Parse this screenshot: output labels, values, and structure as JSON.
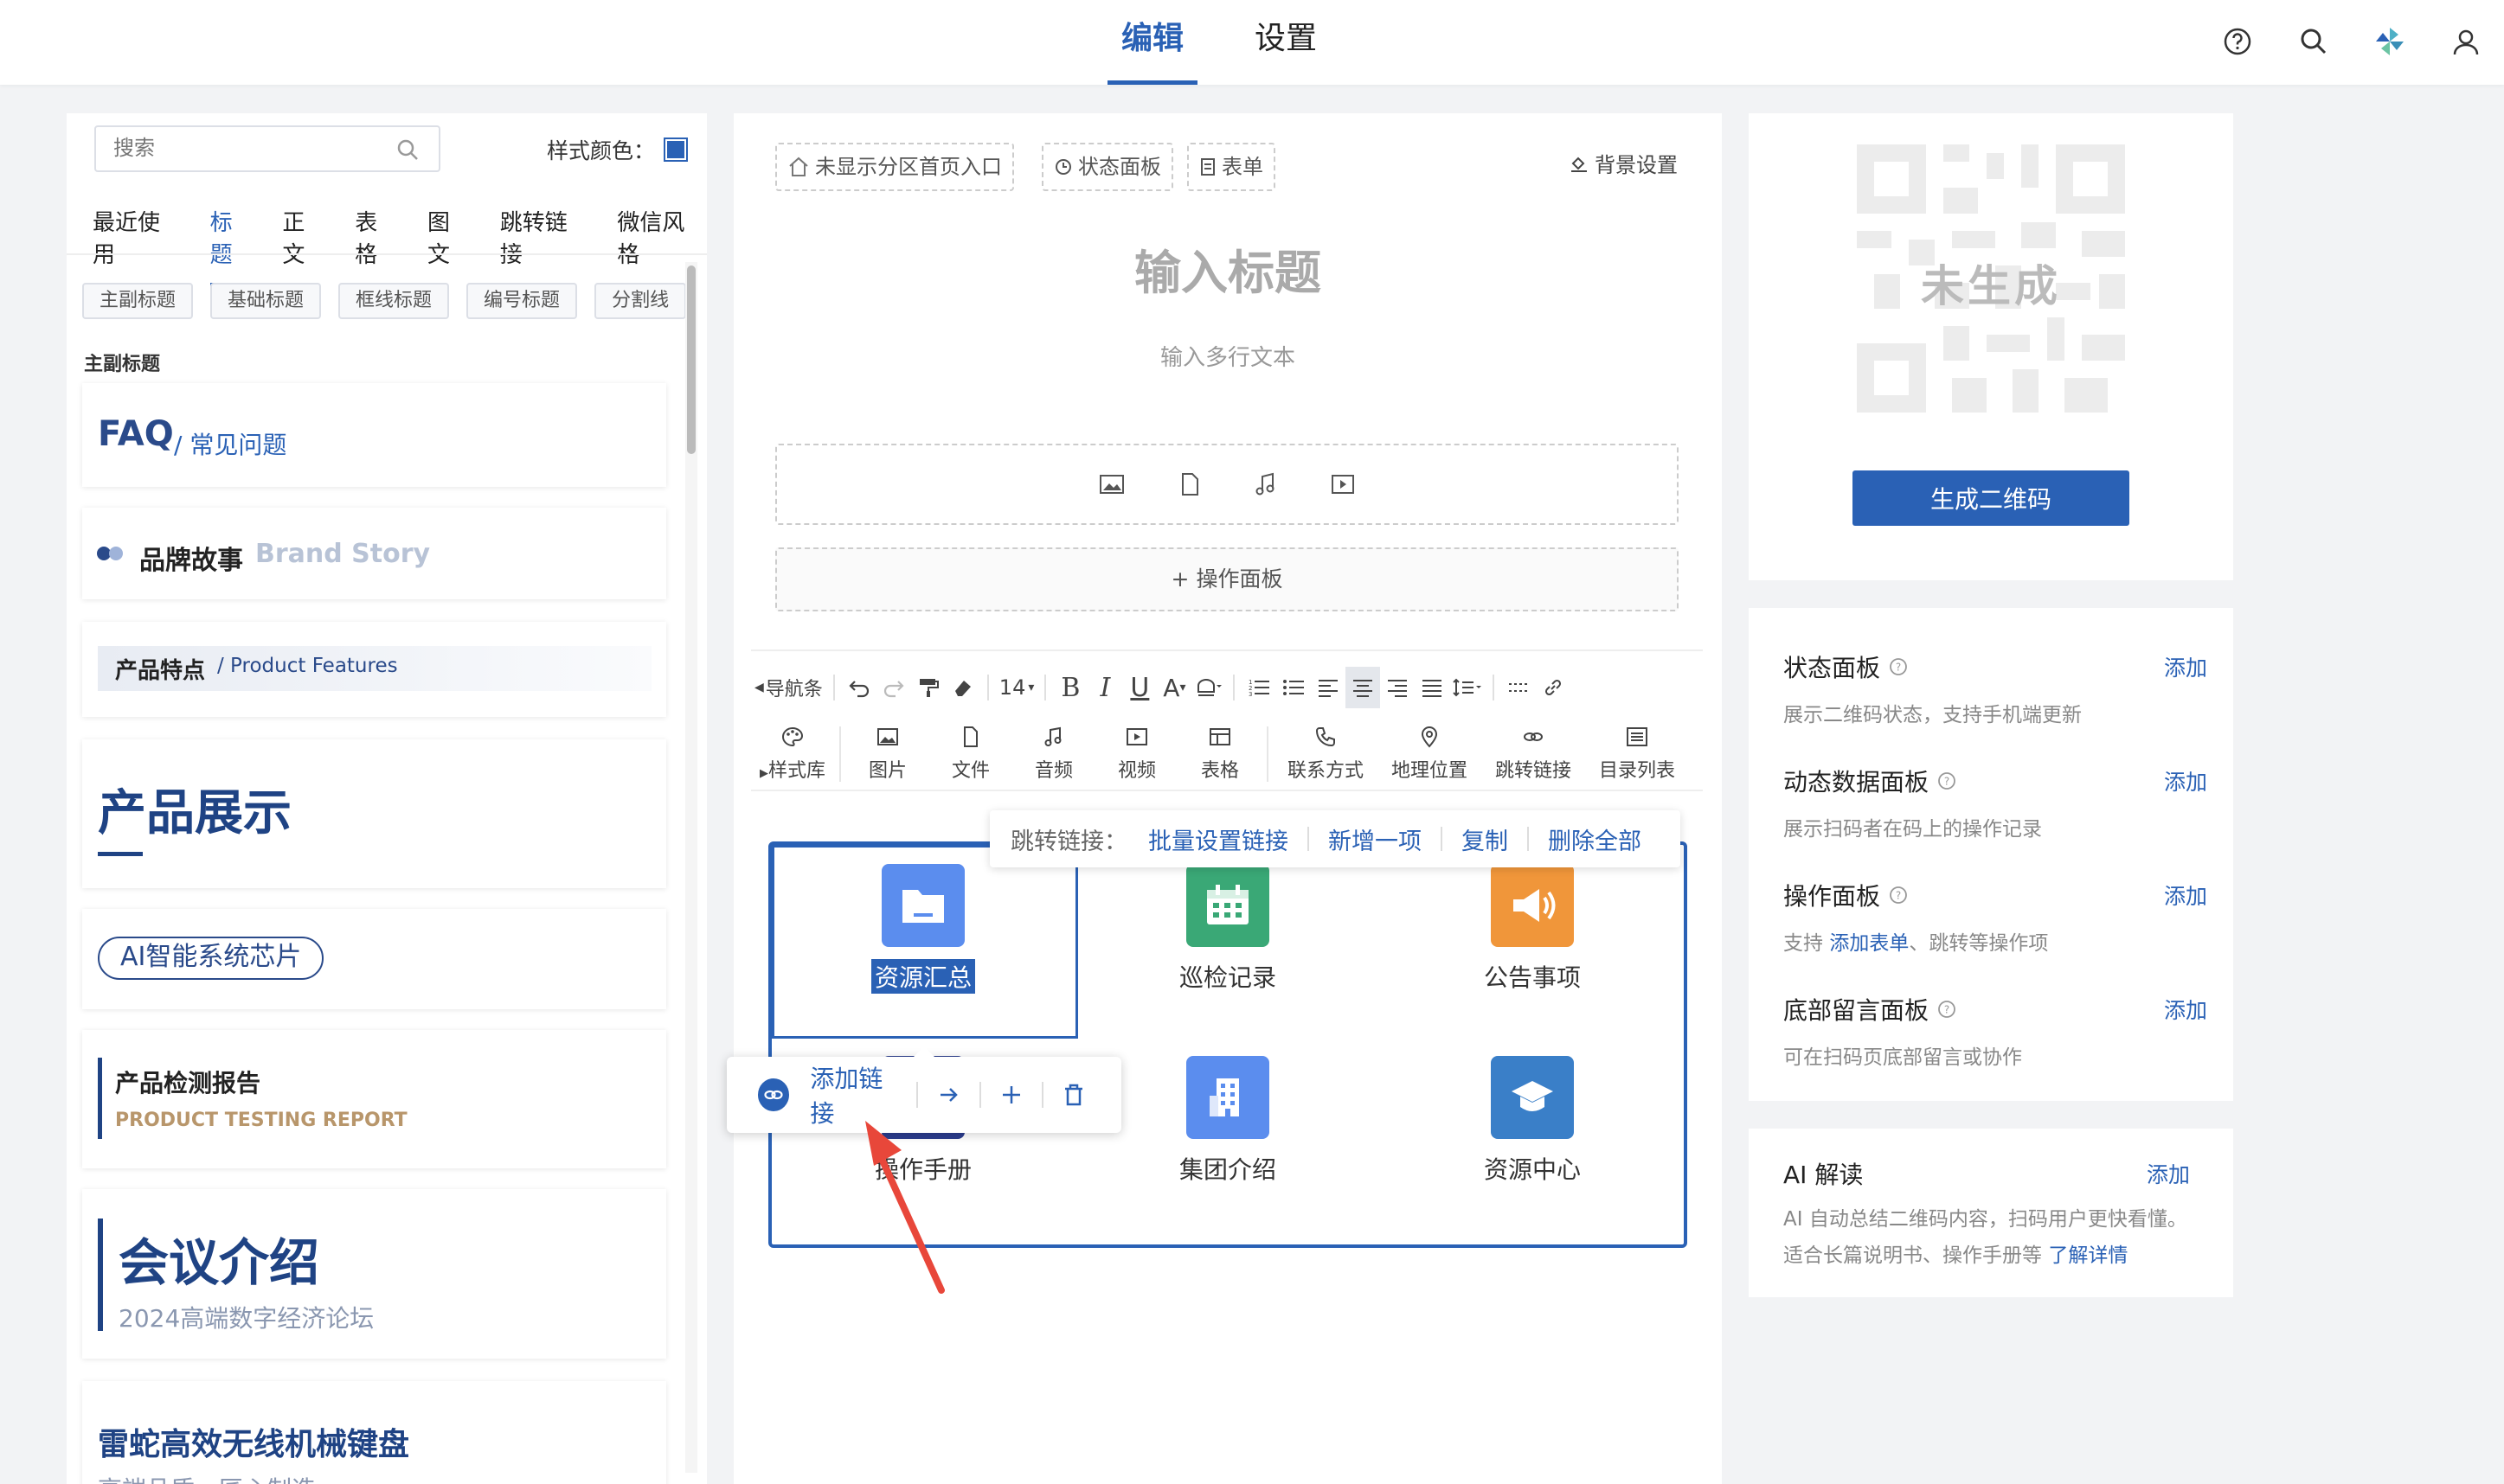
{
  "topnav": {
    "tabs": [
      "编辑",
      "设置"
    ]
  },
  "left": {
    "search_placeholder": "搜索",
    "style_color_label": "样式颜色：",
    "tabs": [
      "最近使用",
      "标题",
      "正文",
      "表格",
      "图文",
      "跳转链接",
      "微信风格"
    ],
    "chips": [
      "主副标题",
      "基础标题",
      "框线标题",
      "编号标题",
      "分割线"
    ],
    "section_title": "主副标题",
    "cards": {
      "faq_main": "FAQ",
      "faq_sub": "/ 常见问题",
      "brand_cn": "品牌故事",
      "brand_en": "Brand Story",
      "features_cn": "产品特点",
      "features_en": "/ Product Features",
      "showcase": "产品展示",
      "chip": "AI智能系统芯片",
      "report_cn": "产品检测报告",
      "report_en": "PRODUCT TESTING REPORT",
      "meeting_title": "会议介绍",
      "meeting_sub": "2024高端数字经济论坛",
      "keyboard_title": "雷蛇高效无线机械键盘",
      "keyboard_sub": "高端品质，匠心制造"
    }
  },
  "mid": {
    "tags": [
      "未显示分区首页入口",
      "状态面板",
      "表单"
    ],
    "bg_settings": "背景设置",
    "title_placeholder": "输入标题",
    "text_placeholder": "输入多行文本",
    "op_panel": "+ 操作面板",
    "toolbar": {
      "nav": "导航条",
      "font_size": "14",
      "style_lib": "样式库",
      "inserts": [
        "图片",
        "文件",
        "音频",
        "视频",
        "表格",
        "联系方式",
        "地理位置",
        "跳转链接",
        "目录列表"
      ]
    },
    "linkbar": {
      "label": "跳转链接：",
      "actions": [
        "批量设置链接",
        "新增一项",
        "复制",
        "删除全部"
      ]
    },
    "grid": [
      {
        "label": "资源汇总",
        "color": "#5b8dee"
      },
      {
        "label": "巡检记录",
        "color": "#3aa876"
      },
      {
        "label": "公告事项",
        "color": "#f0963a"
      },
      {
        "label": "操作手册",
        "color": "#2c3e8f"
      },
      {
        "label": "集团介绍",
        "color": "#5b8dee"
      },
      {
        "label": "资源中心",
        "color": "#3a7fc8"
      }
    ],
    "popup": {
      "add_link": "添加链接"
    }
  },
  "right": {
    "qr_placeholder": "未生成",
    "generate_btn": "生成二维码",
    "panels": [
      {
        "title": "状态面板",
        "desc": "展示二维码状态，支持手机端更新",
        "add": "添加"
      },
      {
        "title": "动态数据面板",
        "desc": "展示扫码者在码上的操作记录",
        "add": "添加"
      },
      {
        "title": "操作面板",
        "desc_pre": "支持",
        "desc_link": "添加表单",
        "desc_post": "、跳转等操作项",
        "add": "添加"
      },
      {
        "title": "底部留言面板",
        "desc": "可在扫码页底部留言或协作",
        "add": "添加"
      }
    ],
    "ai": {
      "title": "AI 解读",
      "add": "添加",
      "desc": "AI 自动总结二维码内容，扫码用户更快看懂。适合长篇说明书、操作手册等",
      "more": "了解详情"
    }
  },
  "colors": {
    "accent": "#2a61b5"
  }
}
